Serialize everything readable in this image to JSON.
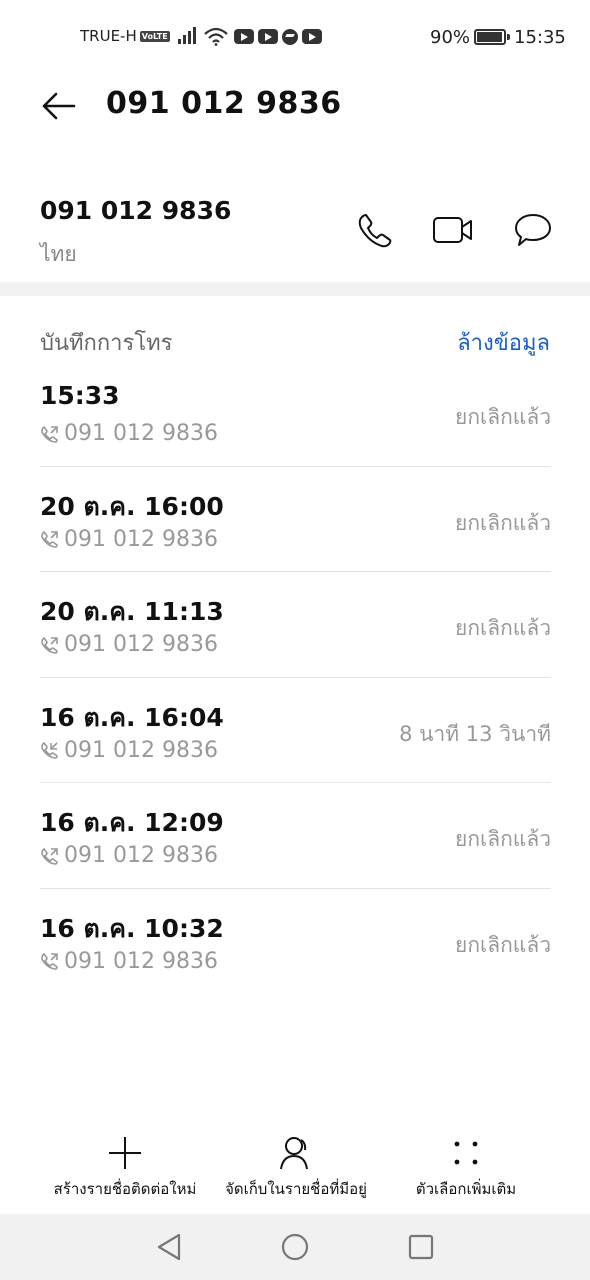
{
  "status_bar": {
    "carrier": "TRUE-H",
    "volte": "VoLTE",
    "battery_percent": "90%",
    "time": "15:35"
  },
  "header": {
    "title": "091 012 9836"
  },
  "contact": {
    "number": "091 012 9836",
    "location": "ไทย"
  },
  "call_log": {
    "title": "บันทึกการโทร",
    "clear_label": "ล้างข้อมูล",
    "items": [
      {
        "time": "15:33",
        "number": "091 012 9836",
        "status": "ยกเลิกแล้ว",
        "direction": "outgoing"
      },
      {
        "time": "20 ต.ค. 16:00",
        "number": "091 012 9836",
        "status": "ยกเลิกแล้ว",
        "direction": "outgoing"
      },
      {
        "time": "20 ต.ค. 11:13",
        "number": "091 012 9836",
        "status": "ยกเลิกแล้ว",
        "direction": "outgoing"
      },
      {
        "time": "16 ต.ค. 16:04",
        "number": "091 012 9836",
        "status": "8 นาที 13 วินาที",
        "direction": "incoming"
      },
      {
        "time": "16 ต.ค. 12:09",
        "number": "091 012 9836",
        "status": "ยกเลิกแล้ว",
        "direction": "outgoing"
      },
      {
        "time": "16 ต.ค. 10:32",
        "number": "091 012 9836",
        "status": "ยกเลิกแล้ว",
        "direction": "outgoing"
      }
    ]
  },
  "bottom_actions": {
    "new_contact": "สร้างรายชื่อติดต่อใหม่",
    "save_existing": "จัดเก็บในรายชื่อที่มีอยู่",
    "more": "ตัวเลือกเพิ่มเติม"
  },
  "colors": {
    "accent": "#1a5fc7",
    "secondary_text": "#999999",
    "divider": "#e4e4e4",
    "nav_bg": "#f1f1f1"
  }
}
